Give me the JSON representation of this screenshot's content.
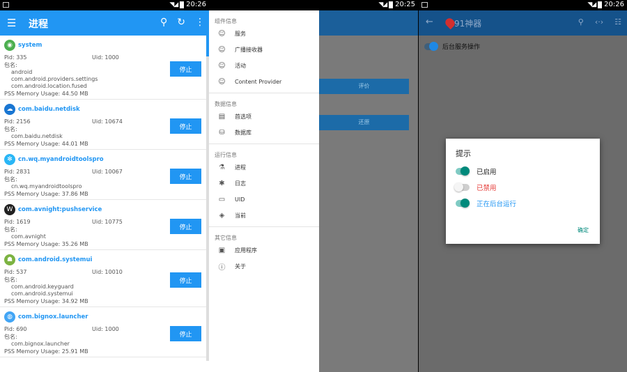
{
  "status": {
    "time1": "20:26",
    "time2": "20:25",
    "time3": "20:26"
  },
  "screen1": {
    "title": "进程",
    "pid_label": "Pid:",
    "uid_label": "Uid:",
    "pkg_label": "包名:",
    "mem_label": "PSS Memory Usage:",
    "stop_label": "停止",
    "processes": [
      {
        "name": "system",
        "pid": "335",
        "uid": "1000",
        "pkgs": [
          "android",
          "com.android.providers.settings",
          "com.android.location.fused"
        ],
        "mem": "44.50 MB",
        "icon_color": "#4caf50",
        "icon": "globe-icon"
      },
      {
        "name": "com.baidu.netdisk",
        "pid": "2156",
        "uid": "10674",
        "pkgs": [
          "com.baidu.netdisk"
        ],
        "mem": "44.01 MB",
        "icon_color": "#1976d2",
        "icon": "cloud-icon"
      },
      {
        "name": "cn.wq.myandroidtoolspro",
        "pid": "2831",
        "uid": "10067",
        "pkgs": [
          "cn.wq.myandroidtoolspro"
        ],
        "mem": "37.86 MB",
        "icon_color": "#29b6f6",
        "icon": "gear-icon"
      },
      {
        "name": "com.avnight:pushservice",
        "pid": "1619",
        "uid": "10775",
        "pkgs": [
          "com.avnight"
        ],
        "mem": "35.26 MB",
        "icon_color": "#212121",
        "icon": "app-icon"
      },
      {
        "name": "com.android.systemui",
        "pid": "537",
        "uid": "10010",
        "pkgs": [
          "com.android.keyguard",
          "com.android.systemui"
        ],
        "mem": "34.92 MB",
        "icon_color": "#7cb342",
        "icon": "android-icon"
      },
      {
        "name": "com.bignox.launcher",
        "pid": "690",
        "uid": "1000",
        "pkgs": [
          "com.bignox.launcher"
        ],
        "mem": "25.91 MB",
        "icon_color": "#42a5f5",
        "icon": "launcher-icon"
      }
    ]
  },
  "screen2": {
    "bg_btn1": "评价",
    "bg_btn2": "还原",
    "drawer": [
      {
        "section": "组件信息",
        "items": [
          {
            "label": "服务",
            "icon": "smile-icon"
          },
          {
            "label": "广播接收器",
            "icon": "smile-icon"
          },
          {
            "label": "活动",
            "icon": "smile-icon"
          },
          {
            "label": "Content Provider",
            "icon": "smile-icon"
          }
        ]
      },
      {
        "section": "数据信息",
        "items": [
          {
            "label": "首选项",
            "icon": "file-icon"
          },
          {
            "label": "数据库",
            "icon": "database-icon"
          }
        ]
      },
      {
        "section": "运行信息",
        "items": [
          {
            "label": "进程",
            "icon": "flask-icon"
          },
          {
            "label": "日志",
            "icon": "bug-icon"
          },
          {
            "label": "UID",
            "icon": "uid-icon"
          },
          {
            "label": "当前",
            "icon": "layers-icon"
          }
        ]
      },
      {
        "section": "其它信息",
        "items": [
          {
            "label": "应用程序",
            "icon": "app-box-icon"
          },
          {
            "label": "关于",
            "icon": "info-icon"
          }
        ]
      }
    ]
  },
  "screen3": {
    "title": "91神器",
    "row_label": "后台服务操作",
    "dialog": {
      "title": "提示",
      "options": [
        {
          "label": "已启用",
          "color": "#222222",
          "state": "on"
        },
        {
          "label": "已禁用",
          "color": "#e53935",
          "state": "off"
        },
        {
          "label": "正在后台运行",
          "color": "#2196f3",
          "state": "on"
        }
      ],
      "ok": "确定"
    }
  }
}
